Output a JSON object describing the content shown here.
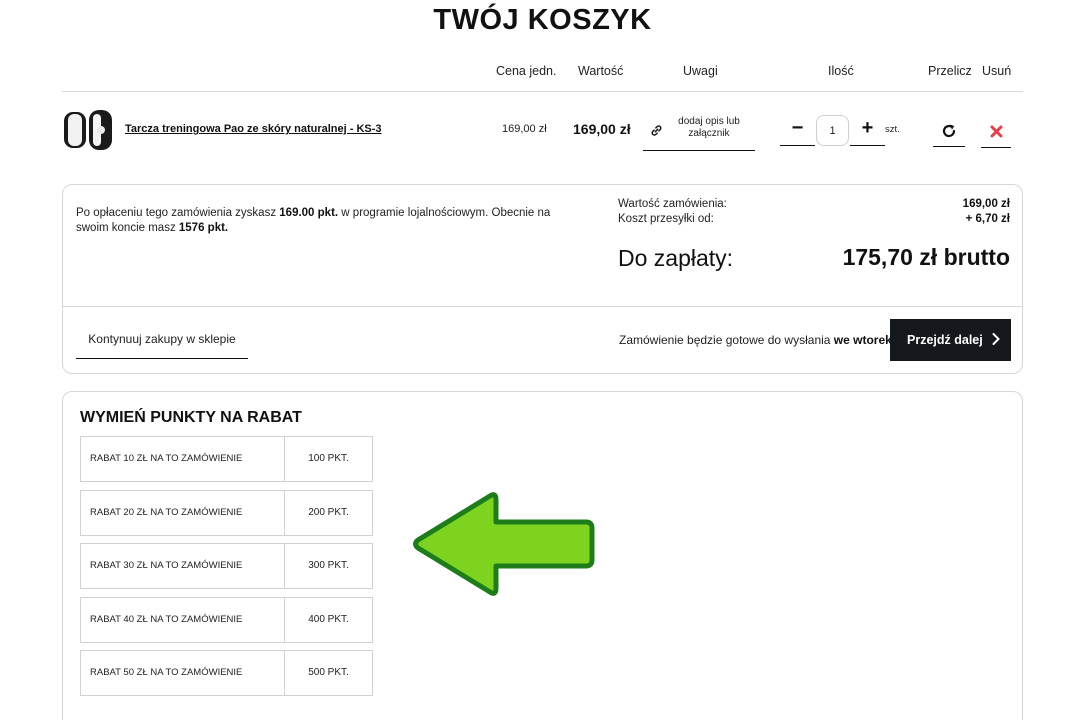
{
  "page": {
    "title": "TWÓJ KOSZYK"
  },
  "table_header": {
    "unit_price": "Cena jedn.",
    "value": "Wartość",
    "notes": "Uwagi",
    "quantity": "Ilość",
    "recalculate": "Przelicz",
    "remove": "Usuń"
  },
  "cart_item": {
    "name": "Tarcza treningowa Pao ze skóry naturalnej - KS-3",
    "unit_price": "169,00 zł",
    "value": "169,00 zł",
    "note_label": "dodaj opis lub załącznik",
    "quantity": "1",
    "unit": "szt."
  },
  "loyalty": {
    "pre": "Po opłaceniu tego zamówienia zyskasz ",
    "points_gain": "169.00 pkt.",
    "mid": " w programie lojalnościowym. Obecnie na swoim koncie masz ",
    "points_balance": "1576 pkt."
  },
  "summary": {
    "order_value_label": "Wartość zamówienia:",
    "order_value": "169,00 zł",
    "shipping_label": "Koszt przesyłki od:",
    "shipping_value": "+ 6,70 zł",
    "total_label": "Do zapłaty:",
    "total_value": "175,70 zł brutto"
  },
  "actions": {
    "continue_label": "Kontynuuj zakupy w sklepie",
    "ready_pre": "Zamówienie będzie gotowe do wysłania ",
    "ready_day": "we wtorek",
    "proceed_label": "Przejdź dalej"
  },
  "rewards": {
    "title": "WYMIEŃ PUNKTY NA RABAT",
    "options": [
      {
        "label": "RABAT 10 ZŁ NA TO ZAMÓWIENIE",
        "points": "100 PKT."
      },
      {
        "label": "RABAT 20 ZŁ NA TO ZAMÓWIENIE",
        "points": "200 PKT."
      },
      {
        "label": "RABAT 30 ZŁ NA TO ZAMÓWIENIE",
        "points": "300 PKT."
      },
      {
        "label": "RABAT 40 ZŁ NA TO ZAMÓWIENIE",
        "points": "400 PKT."
      },
      {
        "label": "RABAT 50 ZŁ NA TO ZAMÓWIENIE",
        "points": "500 PKT."
      }
    ]
  },
  "icons": {
    "note": "link-icon",
    "recalculate": "refresh-icon",
    "remove": "close-icon",
    "proceed": "chevron-right-icon",
    "annotation": "arrow-left-icon"
  },
  "colors": {
    "primary_button": "#15181c",
    "remove_icon": "#e0424b",
    "arrow_fill": "#7ed321",
    "arrow_stroke": "#1e7d1a"
  }
}
